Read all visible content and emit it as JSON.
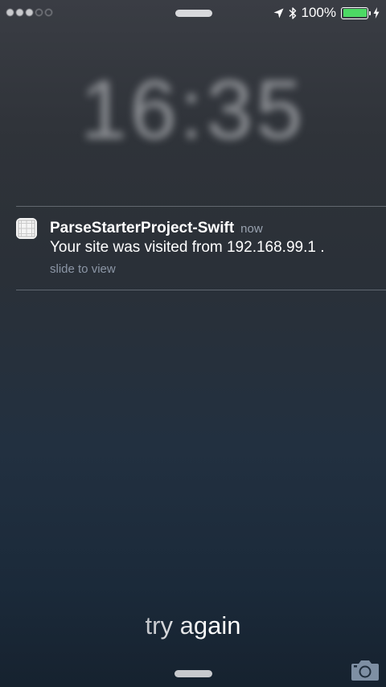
{
  "status_bar": {
    "carrier": "",
    "battery_percent": "100%",
    "battery_level": 1.0,
    "battery_color": "#4cd964",
    "icons": [
      "location-arrow-icon",
      "bluetooth-icon",
      "battery-icon",
      "charging-bolt-icon"
    ]
  },
  "lock_screen": {
    "time": "16:35",
    "date": ""
  },
  "notification": {
    "app_name": "ParseStarterProject-Swift",
    "time": "now",
    "message": "Your site was visited from 192.168.99.1 .",
    "action_hint": "slide to view"
  },
  "unlock": {
    "label": "try again"
  },
  "colors": {
    "accent_battery": "#4cd964",
    "notification_secondary": "#8c96a6"
  }
}
